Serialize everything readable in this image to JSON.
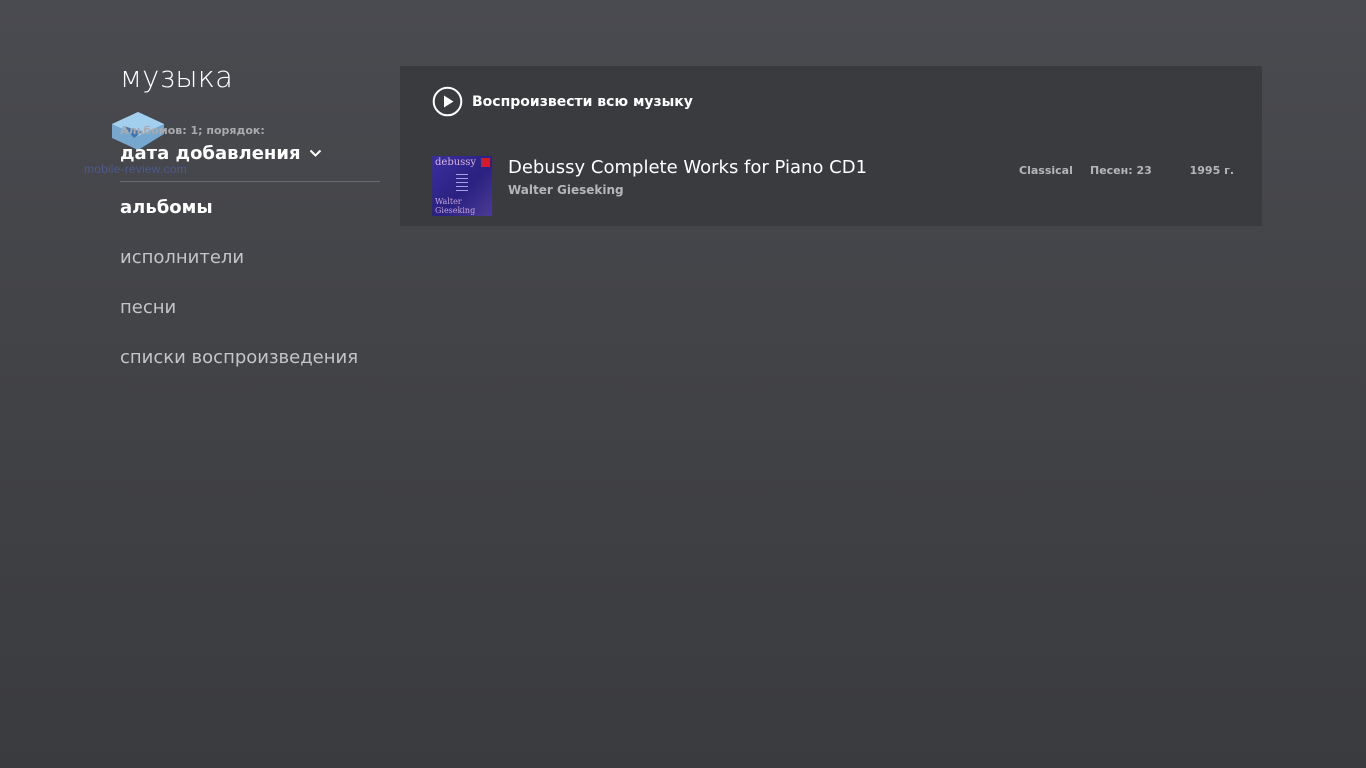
{
  "page": {
    "title": "музыка"
  },
  "watermark": {
    "text": "mobile-review.com"
  },
  "sort": {
    "caption": "Альбомов: 1; порядок:",
    "selected": "дата добавления"
  },
  "nav": {
    "items": [
      {
        "label": "альбомы",
        "active": true
      },
      {
        "label": "исполнители",
        "active": false
      },
      {
        "label": "песни",
        "active": false
      },
      {
        "label": "списки воспроизведения",
        "active": false
      }
    ]
  },
  "play_all": {
    "label": "Воспроизвести всю музыку",
    "icon": "play-circle-icon"
  },
  "albums": [
    {
      "title": "Debussy Complete Works for Piano CD1",
      "artist": "Walter Gieseking",
      "genre": "Classical",
      "songs": "Песен: 23",
      "year": "1995 г.",
      "cover": {
        "title": "debussy",
        "artist_line1": "Walter",
        "artist_line2": "Gieseking"
      }
    }
  ],
  "colors": {
    "background_top": "#4a4b50",
    "background_bottom": "#3a3b3f",
    "panel": "#3a3b3f",
    "text_primary": "#ffffff",
    "text_secondary": "#b5b6ba",
    "watermark": "#4d5a8a"
  }
}
